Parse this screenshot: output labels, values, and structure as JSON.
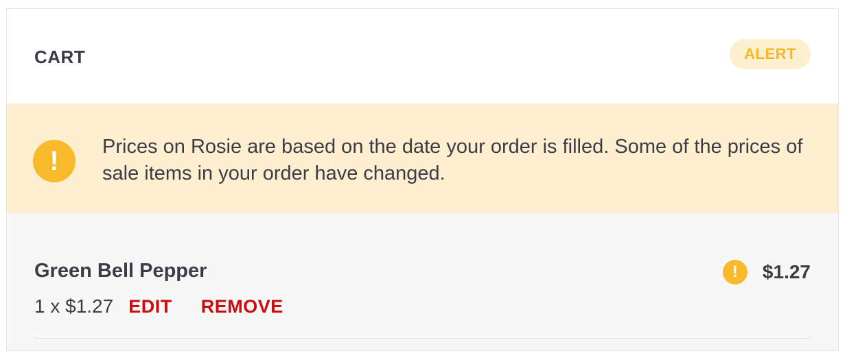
{
  "cart": {
    "title": "CART",
    "alert_badge": "ALERT"
  },
  "banner": {
    "icon": "exclamation-icon",
    "message": "Prices on Rosie are based on the date your order is filled. Some of the prices of sale items in your order have changed."
  },
  "items": [
    {
      "name": "Green Bell Pepper",
      "quantity_price": "1 x $1.27",
      "edit_label": "EDIT",
      "remove_label": "REMOVE",
      "price": "$1.27",
      "price_alert_icon": "exclamation-icon"
    }
  ],
  "colors": {
    "alert_yellow": "#f8b92a",
    "banner_bg": "#fdefcf",
    "action_red": "#d00a0a",
    "text_dark": "#3c3c46"
  }
}
